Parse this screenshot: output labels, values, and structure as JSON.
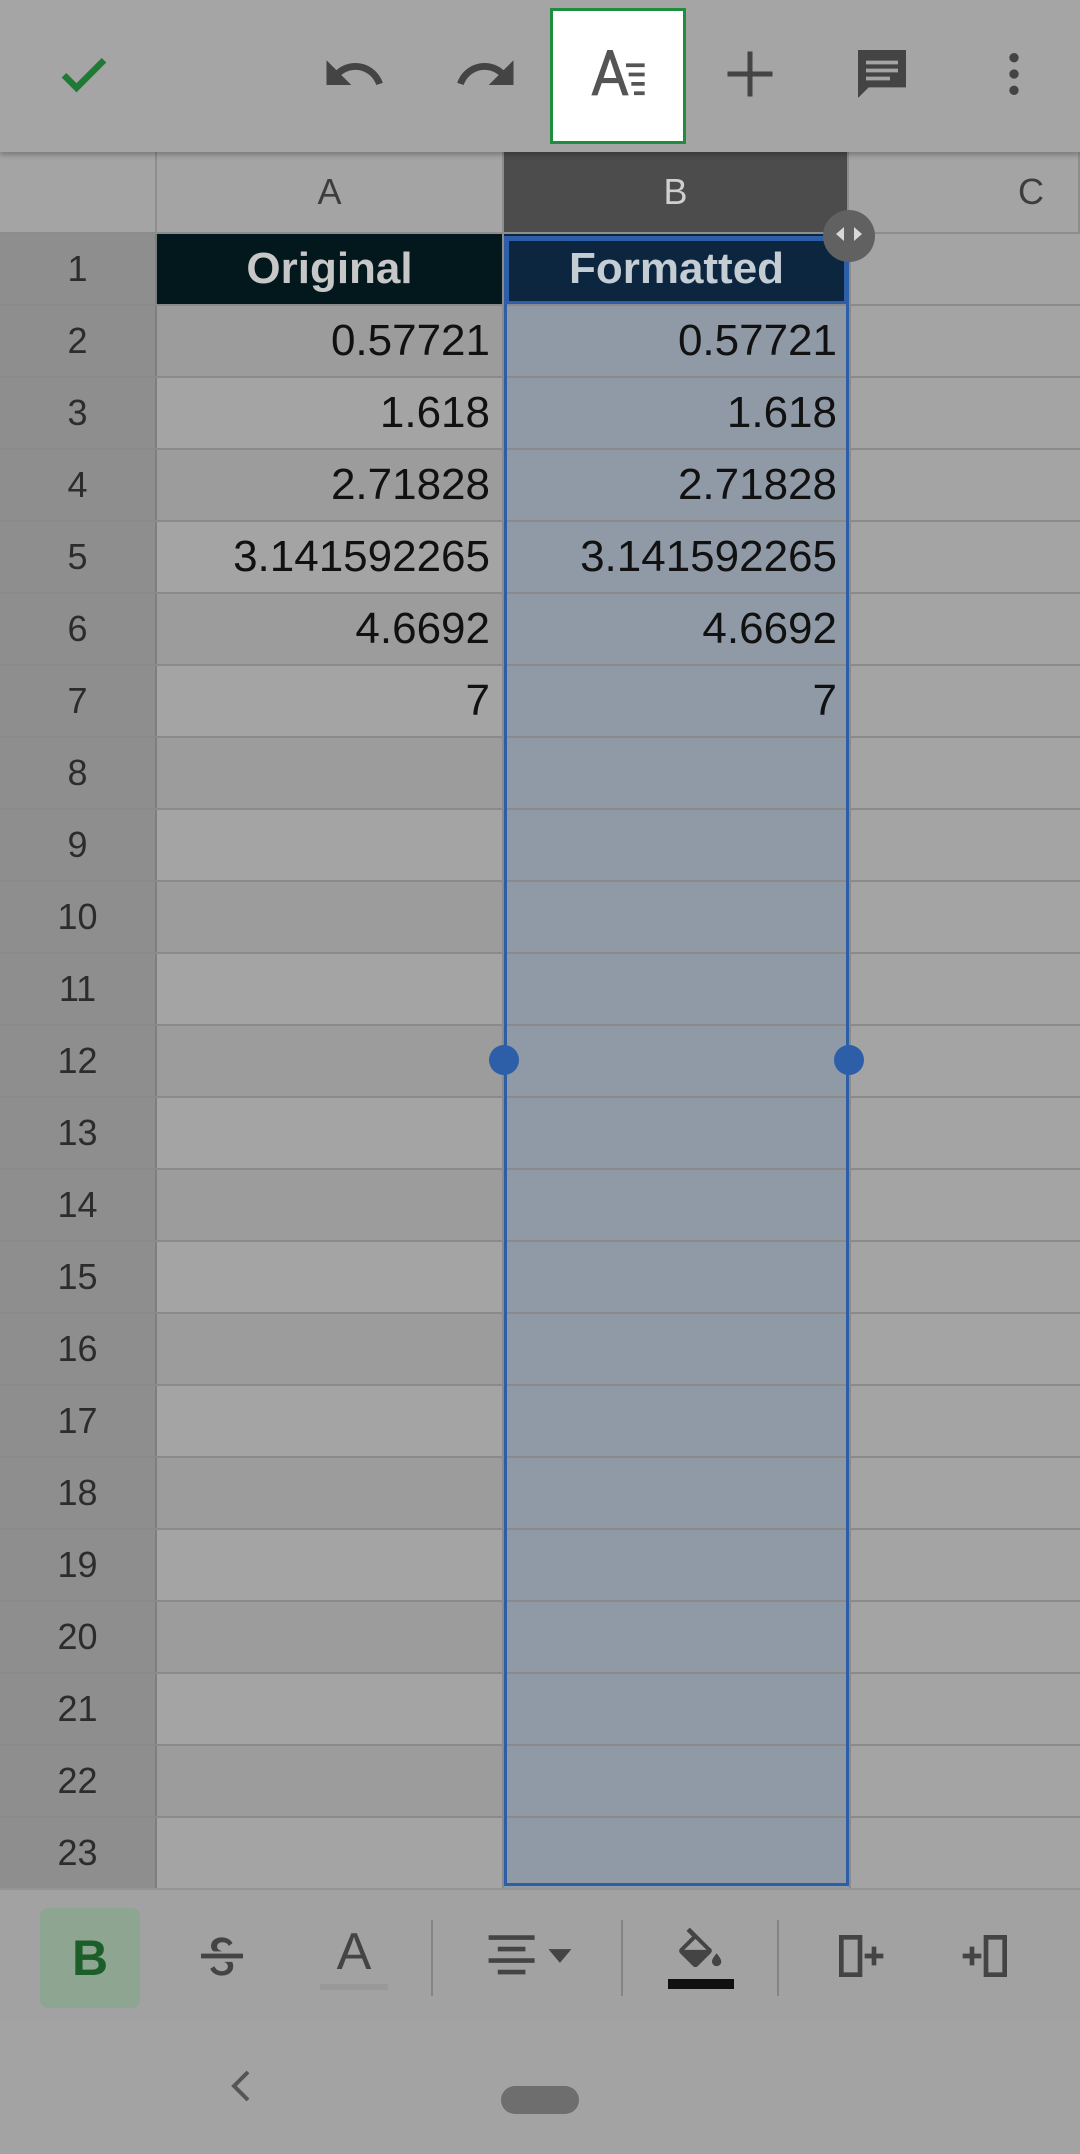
{
  "toolbar": {
    "confirm_icon": "check-icon",
    "undo_icon": "undo-icon",
    "redo_icon": "redo-icon",
    "format_icon": "text-format-icon",
    "insert_icon": "plus-icon",
    "comment_icon": "comment-icon",
    "more_icon": "more-vert-icon",
    "active_button": "format"
  },
  "sheet": {
    "columns": [
      "A",
      "B",
      "C"
    ],
    "selected_column": "B",
    "rows": [
      {
        "num": "1",
        "a": "Original",
        "b": "Formatted"
      },
      {
        "num": "2",
        "a": "0.57721",
        "b": "0.57721"
      },
      {
        "num": "3",
        "a": "1.618",
        "b": "1.618"
      },
      {
        "num": "4",
        "a": "2.71828",
        "b": "2.71828"
      },
      {
        "num": "5",
        "a": "3.141592265",
        "b": "3.141592265"
      },
      {
        "num": "6",
        "a": "4.6692",
        "b": "4.6692"
      },
      {
        "num": "7",
        "a": "7",
        "b": "7"
      },
      {
        "num": "8",
        "a": "",
        "b": ""
      },
      {
        "num": "9",
        "a": "",
        "b": ""
      },
      {
        "num": "10",
        "a": "",
        "b": ""
      },
      {
        "num": "11",
        "a": "",
        "b": ""
      },
      {
        "num": "12",
        "a": "",
        "b": ""
      },
      {
        "num": "13",
        "a": "",
        "b": ""
      },
      {
        "num": "14",
        "a": "",
        "b": ""
      },
      {
        "num": "15",
        "a": "",
        "b": ""
      },
      {
        "num": "16",
        "a": "",
        "b": ""
      },
      {
        "num": "17",
        "a": "",
        "b": ""
      },
      {
        "num": "18",
        "a": "",
        "b": ""
      },
      {
        "num": "19",
        "a": "",
        "b": ""
      },
      {
        "num": "20",
        "a": "",
        "b": ""
      },
      {
        "num": "21",
        "a": "",
        "b": ""
      },
      {
        "num": "22",
        "a": "",
        "b": ""
      },
      {
        "num": "23",
        "a": "",
        "b": ""
      }
    ]
  },
  "format_bar": {
    "bold_label": "B",
    "text_color_label": "A",
    "icons": [
      "bold-icon",
      "strikethrough-icon",
      "text-color-icon",
      "align-icon",
      "fill-color-icon",
      "insert-column-left-icon",
      "insert-column-right-icon"
    ],
    "bold_active": true
  },
  "colors": {
    "accent_green": "#1e8e3e",
    "selection_blue": "#2d5fa8",
    "header_dark": "#02181d"
  }
}
